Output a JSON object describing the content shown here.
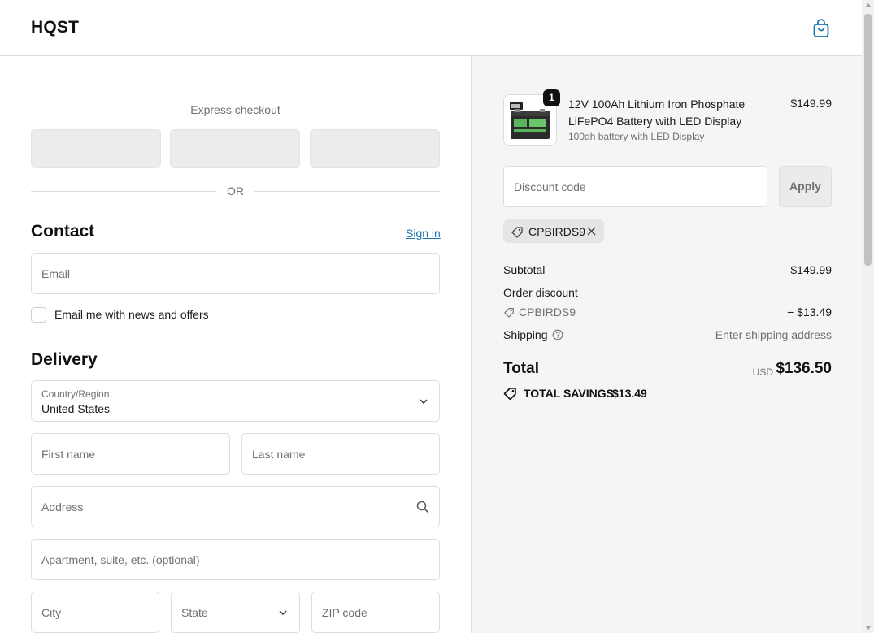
{
  "header": {
    "brand": "HQST",
    "cart_icon": "shopping-bag-icon"
  },
  "express_checkout": {
    "label": "Express checkout",
    "buttons": 3,
    "separator": "OR"
  },
  "contact": {
    "title": "Contact",
    "sign_in": "Sign in",
    "email_placeholder": "Email",
    "newsletter_label": "Email me with news and offers",
    "newsletter_checked": false
  },
  "delivery": {
    "title": "Delivery",
    "country_label": "Country/Region",
    "country_value": "United States",
    "first_name_placeholder": "First name",
    "last_name_placeholder": "Last name",
    "address_placeholder": "Address",
    "apartment_placeholder": "Apartment, suite, etc. (optional)",
    "city_placeholder": "City",
    "state_placeholder": "State",
    "zip_placeholder": "ZIP code"
  },
  "order": {
    "product": {
      "quantity": "1",
      "title": "12V 100Ah Lithium Iron Phosphate LiFePO4 Battery with LED Display",
      "variant": "100ah battery with LED Display",
      "price": "$149.99"
    },
    "discount_placeholder": "Discount code",
    "apply_label": "Apply",
    "applied_code": "CPBIRDS9",
    "subtotal_label": "Subtotal",
    "subtotal_value": "$149.99",
    "order_discount_label": "Order discount",
    "discount_code": "CPBIRDS9",
    "discount_value": "− $13.49",
    "shipping_label": "Shipping",
    "shipping_value": "Enter shipping address",
    "total_label": "Total",
    "currency": "USD",
    "total_value": "$136.50",
    "savings_label": "TOTAL SAVINGS",
    "savings_value": "$13.49"
  },
  "colors": {
    "link": "#1773b0",
    "summary_bg": "#f5f5f5",
    "border": "#dedede"
  }
}
